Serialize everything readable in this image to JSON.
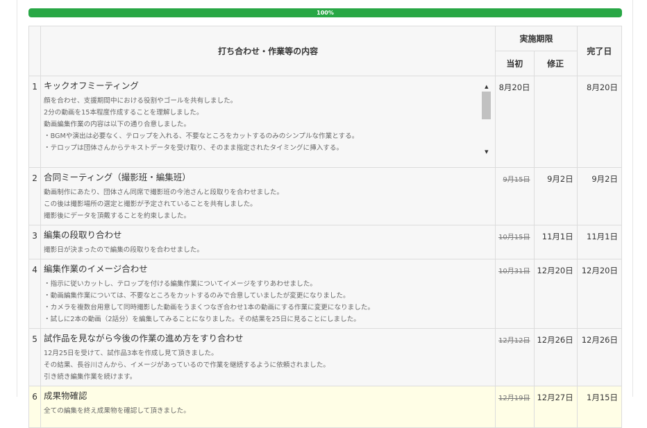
{
  "progress": {
    "label": "100%",
    "value": 1.0
  },
  "table": {
    "headers": {
      "content": "打ち合わせ・作業等の内容",
      "period": "実施期限",
      "original": "当初",
      "revised": "修正",
      "done": "完了日"
    },
    "rows": [
      {
        "num": "1",
        "title": "キックオフミーティング",
        "desc": [
          "顔を合わせ、支援期間中における役割やゴールを共有しました。",
          "2分の動画を15本程度作成することを理解しました。",
          "動画編集作業の内容は以下の通り合意しました。",
          "・BGMや演出は必要なく、テロップを入れる、不要なところをカットするのみのシンプルな作業とする。",
          "・テロップは団体さんからテキストデータを受け取り、そのまま指定されたタイミングに挿入する。"
        ],
        "original": "8月20日",
        "revised": "",
        "done": "8月20日"
      },
      {
        "num": "2",
        "title": "合同ミーティング（撮影班・編集班）",
        "desc": [
          "動画制作にあたり、団体さん同席で撮影班の今池さんと段取りを合わせました。",
          "この後は撮影場所の選定と撮影が予定されていることを共有しました。",
          "撮影後にデータを頂戴することを約束しました。"
        ],
        "original": "9月15日",
        "revised": "9月2日",
        "done": "9月2日"
      },
      {
        "num": "3",
        "title": "編集の段取り合わせ",
        "desc": [
          "撮影日が決まったので編集の段取りを合わせました。"
        ],
        "original": "10月15日",
        "revised": "11月1日",
        "done": "11月1日"
      },
      {
        "num": "4",
        "title": "編集作業のイメージ合わせ",
        "desc": [
          "・指示に従いカットし、テロップを付ける編集作業についてイメージをすりあわせました。",
          "・動画編集作業については、不要なところをカットするのみで合意していましたが変更になりました。",
          "・カメラを複数台用意して同時撮影した動画をうまくつなぎ合わせ1本の動画にする作業に変更になりました。",
          "・試しに2本の動画（2話分）を編集してみることになりました。その結果を25日に見ることにしました。"
        ],
        "original": "10月31日",
        "revised": "12月20日",
        "done": "12月20日"
      },
      {
        "num": "5",
        "title": "試作品を見ながら今後の作業の進め方をすり合わせ",
        "desc": [
          "12月25日を受けて、試作品3本を作成し見て頂きました。",
          "その結果、長谷川さんから、イメージがあっているので作業を継続するように依頼されました。",
          "引き続き編集作業を続けます。"
        ],
        "original": "12月12日",
        "revised": "12月26日",
        "done": "12月26日"
      },
      {
        "num": "6",
        "title": "成果物確認",
        "desc": [
          "全ての編集を終え成果物を確認して頂きました。"
        ],
        "original": "12月19日",
        "revised": "12月27日",
        "done": "1月15日"
      }
    ]
  }
}
